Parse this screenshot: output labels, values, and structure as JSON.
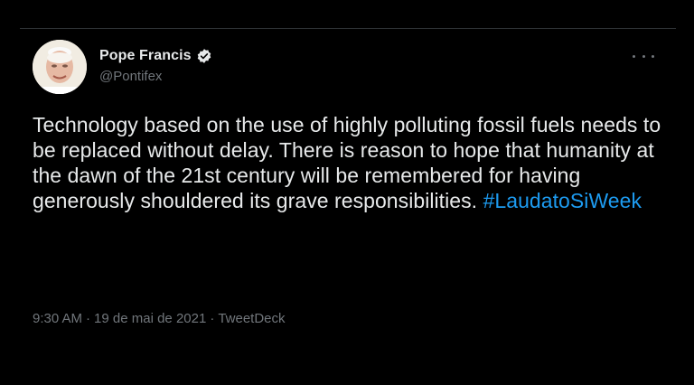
{
  "tweet": {
    "display_name": "Pope Francis",
    "handle": "@Pontifex",
    "text": "Technology based on the use of highly polluting fossil fuels needs to be replaced without delay. There is reason to hope that humanity at the dawn of the 21st century will be remembered for having generously shouldered its grave responsibilities. ",
    "hashtag": "#LaudatoSiWeek",
    "time": "9:30 AM",
    "date": "19 de mai de 2021",
    "source": "TweetDeck",
    "separator": "·"
  },
  "icons": {
    "verified": "verified-badge-icon",
    "more": "more-options-icon",
    "avatar": "avatar"
  },
  "colors": {
    "background": "#000000",
    "text": "#e7e9ea",
    "secondary": "#71767b",
    "link": "#1d9bf0",
    "divider": "#2f3336"
  }
}
